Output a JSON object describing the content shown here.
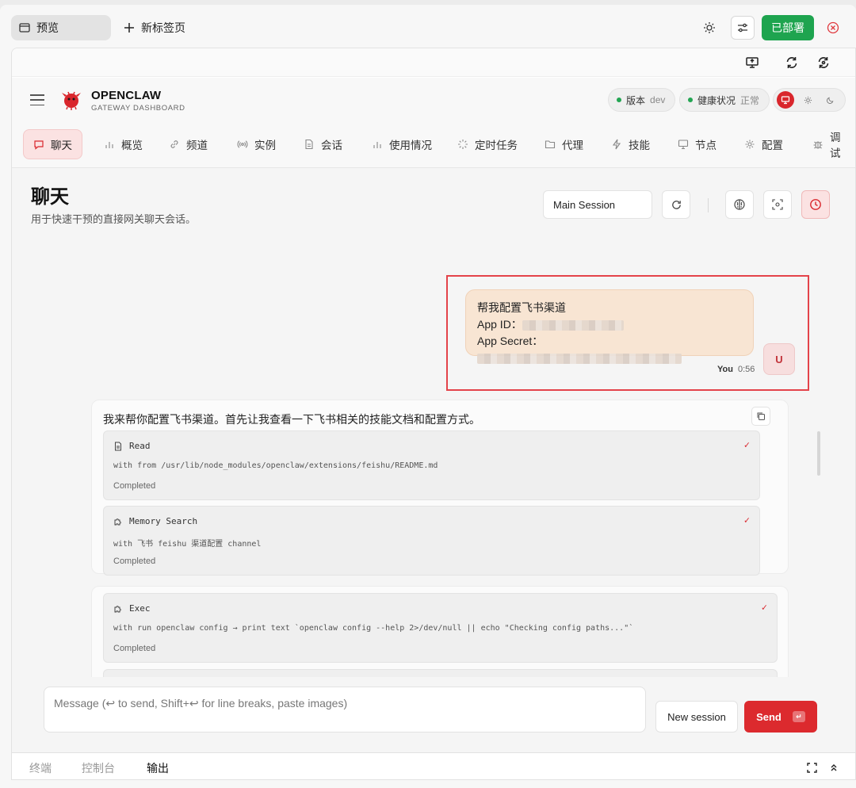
{
  "tabbar": {
    "preview_tab": "预览",
    "new_tab": "新标签页",
    "deploy_button": "已部署"
  },
  "app": {
    "brand_title": "OPENCLAW",
    "brand_subtitle": "GATEWAY DASHBOARD",
    "version_label": "版本",
    "version_value": "dev",
    "health_label": "健康状况",
    "health_value": "正常"
  },
  "nav": {
    "items": [
      {
        "label": "聊天",
        "icon": "chat-icon"
      },
      {
        "label": "概览",
        "icon": "bar-chart-icon"
      },
      {
        "label": "频道",
        "icon": "link-icon"
      },
      {
        "label": "实例",
        "icon": "radio-icon"
      },
      {
        "label": "会话",
        "icon": "document-icon"
      },
      {
        "label": "使用情况",
        "icon": "bar-chart-icon"
      },
      {
        "label": "定时任务",
        "icon": "loader-icon"
      },
      {
        "label": "代理",
        "icon": "folder-icon"
      },
      {
        "label": "技能",
        "icon": "lightning-icon"
      },
      {
        "label": "节点",
        "icon": "monitor-icon"
      },
      {
        "label": "配置",
        "icon": "gear-icon"
      },
      {
        "label": "调试",
        "icon": "bug-icon"
      }
    ],
    "active_index": 0
  },
  "page": {
    "title": "聊天",
    "subtitle": "用于快速干预的直接网关聊天会话。",
    "session_value": "Main Session"
  },
  "user_message": {
    "line1": "帮我配置飞书渠道",
    "app_id_label": "App ID：",
    "app_secret_label": "App Secret：",
    "sender": "You",
    "time": "0:56",
    "avatar": "U"
  },
  "assistant": {
    "text": "我来帮你配置飞书渠道。首先让我查看一下飞书相关的技能文档和配置方式。",
    "tools": [
      {
        "name": "Read",
        "args": "with from /usr/lib/node_modules/openclaw/extensions/feishu/README.md",
        "status": "Completed",
        "icon": "document-icon"
      },
      {
        "name": "Memory Search",
        "args": "with 飞书 feishu 渠道配置 channel",
        "status": "Completed",
        "icon": "puzzle-icon"
      }
    ],
    "tools2": [
      {
        "name": "Exec",
        "args": "with run openclaw config → print text `openclaw config --help 2>/dev/null || echo \"Checking config paths...\"`",
        "status": "Completed",
        "icon": "puzzle-icon"
      }
    ]
  },
  "composer": {
    "placeholder": "Message (↩ to send, Shift+↩ for line breaks, paste images)",
    "new_session": "New session",
    "send": "Send",
    "send_kbd": "↵"
  },
  "bottom_panel": {
    "tabs": [
      "终端",
      "控制台",
      "输出"
    ],
    "active_index": 2
  },
  "colors": {
    "accent": "#dc2a2e",
    "deploy_green": "#1ea44f",
    "user_bubble": "#f8e5d3",
    "highlight": "#e4434a"
  }
}
